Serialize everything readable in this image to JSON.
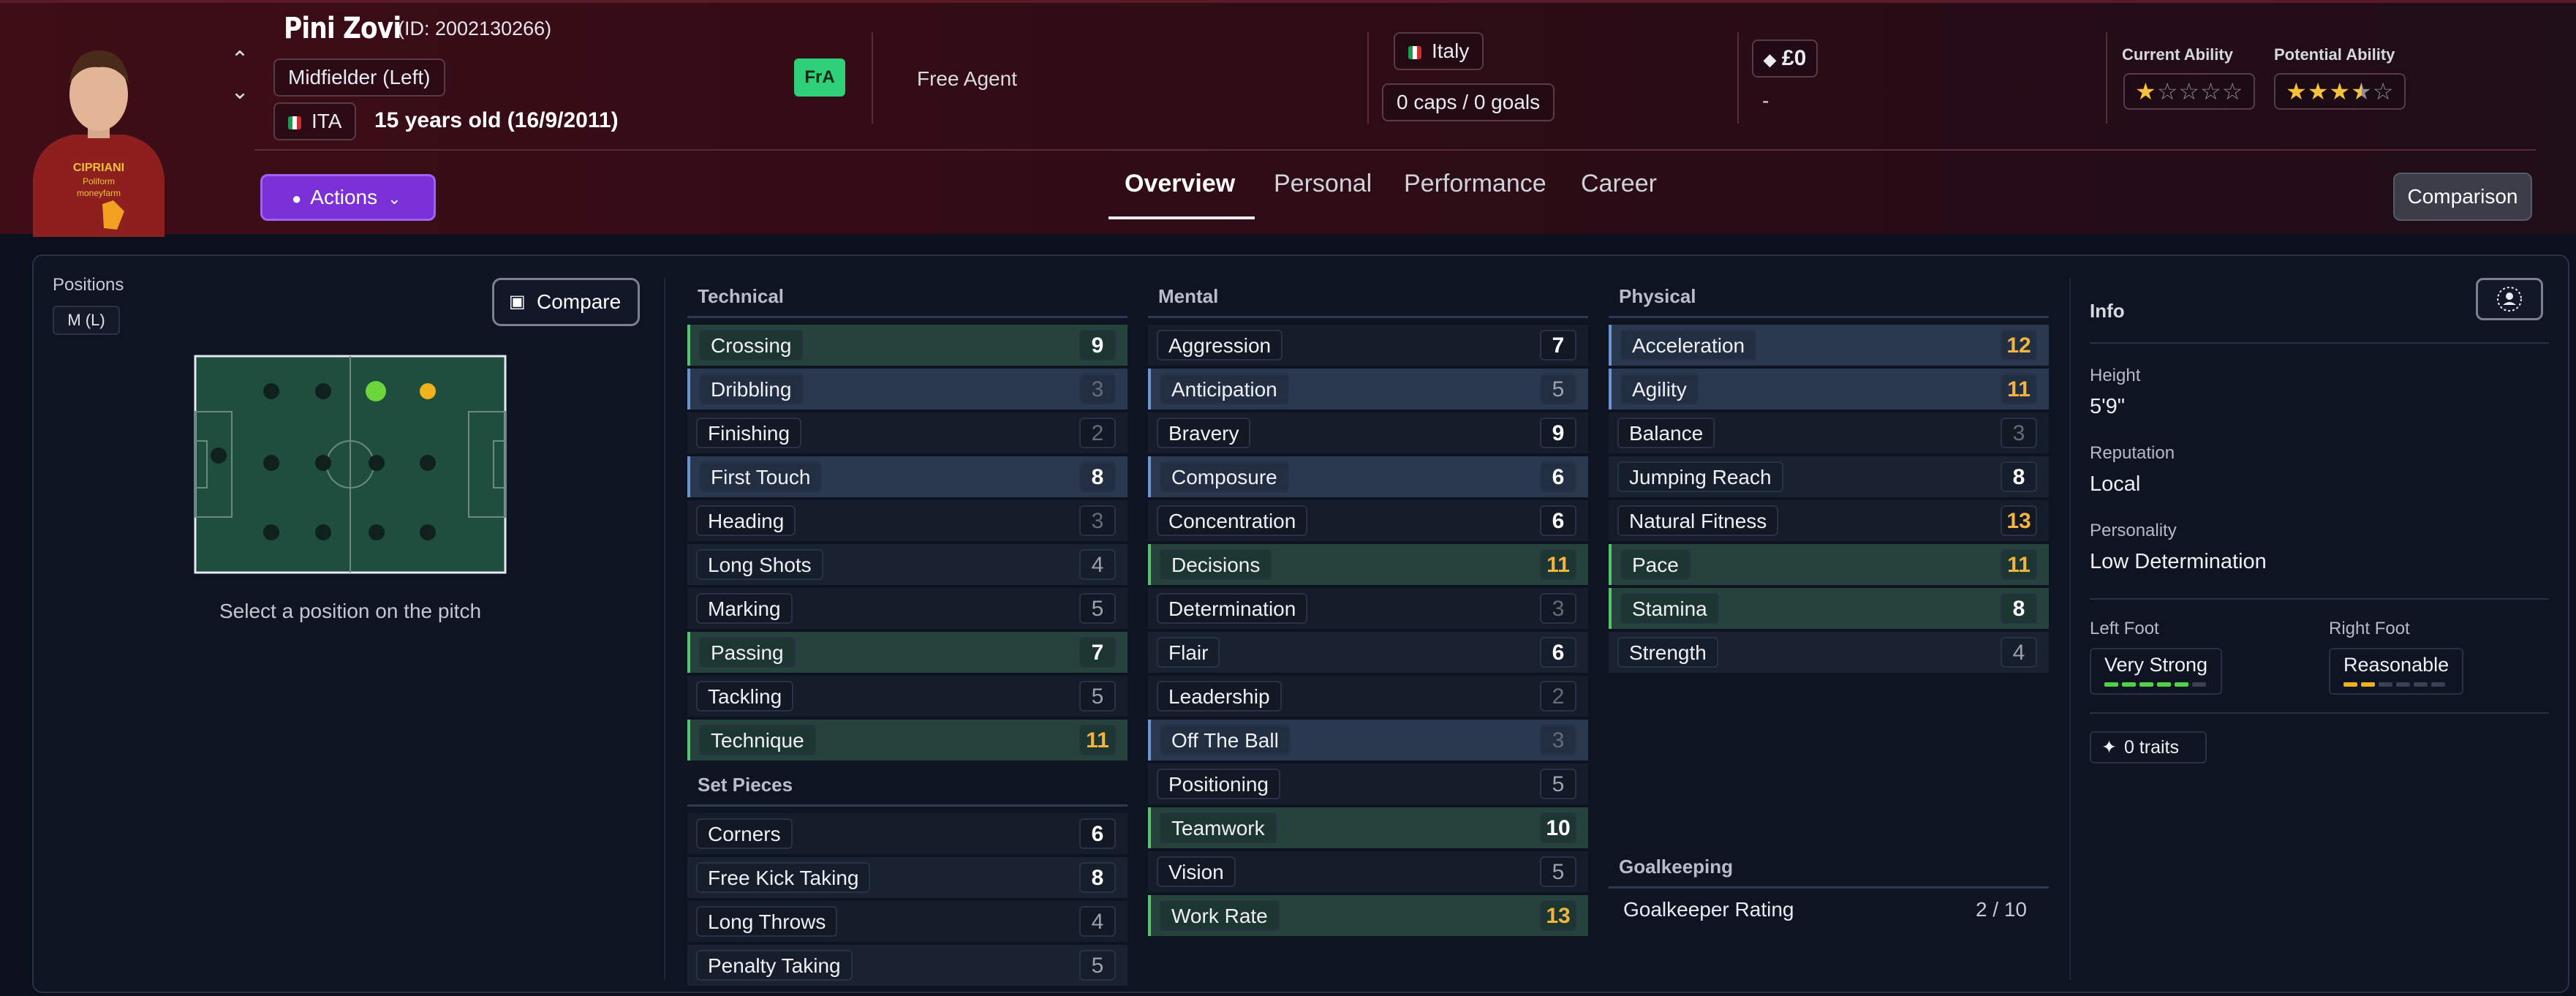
{
  "player": {
    "name": "Pini Zovi",
    "id_text": "(ID: 2002130266)",
    "position_text": "Midfielder (Left)",
    "nation_code": "ITA",
    "age_text": "15 years old (16/9/2011)",
    "status_badge": "FrA",
    "club": "Free Agent",
    "nationality": "Italy",
    "caps_text": "0 caps / 0 goals",
    "value": "£0",
    "value_sub": "-",
    "current_ability_label": "Current Ability",
    "potential_ability_label": "Potential Ability",
    "current_ability_stars": 1,
    "potential_ability_stars": 3.5,
    "max_stars": 5
  },
  "colors": {
    "accent_purple": "#7b2fd6",
    "good_green": "#52c56e",
    "key_blue": "#6e93d0",
    "highlight_orange": "#f3b340",
    "status_green": "#2fd07a"
  },
  "actions_label": "Actions",
  "tabs": [
    {
      "label": "Overview",
      "active": true
    },
    {
      "label": "Personal",
      "active": false
    },
    {
      "label": "Performance",
      "active": false
    },
    {
      "label": "Career",
      "active": false
    }
  ],
  "comparison_label": "Comparison",
  "positions": {
    "label": "Positions",
    "chip": "M (L)",
    "compare_label": "Compare",
    "select_hint": "Select a position on the pitch"
  },
  "technical": {
    "title": "Technical",
    "attributes": [
      {
        "name": "Crossing",
        "value": "9"
      },
      {
        "name": "Dribbling",
        "value": "3"
      },
      {
        "name": "Finishing",
        "value": "2"
      },
      {
        "name": "First Touch",
        "value": "8"
      },
      {
        "name": "Heading",
        "value": "3"
      },
      {
        "name": "Long Shots",
        "value": "4"
      },
      {
        "name": "Marking",
        "value": "5"
      },
      {
        "name": "Passing",
        "value": "7"
      },
      {
        "name": "Tackling",
        "value": "5"
      },
      {
        "name": "Technique",
        "value": "11"
      }
    ]
  },
  "set_pieces": {
    "title": "Set Pieces",
    "attributes": [
      {
        "name": "Corners",
        "value": "6"
      },
      {
        "name": "Free Kick Taking",
        "value": "8"
      },
      {
        "name": "Long Throws",
        "value": "4"
      },
      {
        "name": "Penalty Taking",
        "value": "5"
      }
    ]
  },
  "mental": {
    "title": "Mental",
    "attributes": [
      {
        "name": "Aggression",
        "value": "7"
      },
      {
        "name": "Anticipation",
        "value": "5"
      },
      {
        "name": "Bravery",
        "value": "9"
      },
      {
        "name": "Composure",
        "value": "6"
      },
      {
        "name": "Concentration",
        "value": "6"
      },
      {
        "name": "Decisions",
        "value": "11"
      },
      {
        "name": "Determination",
        "value": "3"
      },
      {
        "name": "Flair",
        "value": "6"
      },
      {
        "name": "Leadership",
        "value": "2"
      },
      {
        "name": "Off The Ball",
        "value": "3"
      },
      {
        "name": "Positioning",
        "value": "5"
      },
      {
        "name": "Teamwork",
        "value": "10"
      },
      {
        "name": "Vision",
        "value": "5"
      },
      {
        "name": "Work Rate",
        "value": "13"
      }
    ]
  },
  "physical": {
    "title": "Physical",
    "attributes": [
      {
        "name": "Acceleration",
        "value": "12"
      },
      {
        "name": "Agility",
        "value": "11"
      },
      {
        "name": "Balance",
        "value": "3"
      },
      {
        "name": "Jumping Reach",
        "value": "8"
      },
      {
        "name": "Natural Fitness",
        "value": "13"
      },
      {
        "name": "Pace",
        "value": "11"
      },
      {
        "name": "Stamina",
        "value": "8"
      },
      {
        "name": "Strength",
        "value": "4"
      }
    ]
  },
  "goalkeeping": {
    "title": "Goalkeeping",
    "rating_label": "Goalkeeper Rating",
    "rating_value": "2 / 10"
  },
  "info": {
    "title": "Info",
    "height_label": "Height",
    "height": "5'9\"",
    "reputation_label": "Reputation",
    "reputation": "Local",
    "personality_label": "Personality",
    "personality": "Low Determination",
    "left_foot_label": "Left Foot",
    "left_foot": "Very Strong",
    "left_foot_level": 5,
    "right_foot_label": "Right Foot",
    "right_foot": "Reasonable",
    "right_foot_level": 2,
    "foot_level_max": 6,
    "traits": "0 traits"
  }
}
